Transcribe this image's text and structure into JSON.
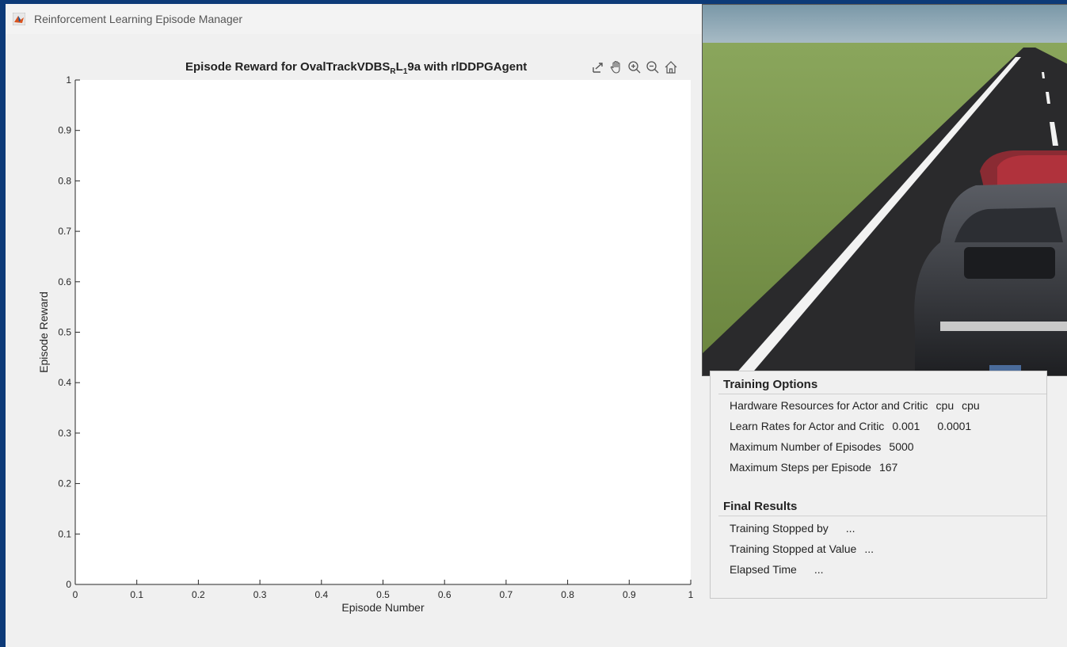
{
  "window": {
    "title": "Reinforcement Learning Episode Manager"
  },
  "plot": {
    "title_main": "Episode Reward for OvalTrackVDBS",
    "title_sub1": "R",
    "title_mid": "L",
    "title_sub2": "1",
    "title_end": "9a with rlDDPGAgent",
    "toolbar": [
      "export-icon",
      "pan-hand-icon",
      "zoom-in-icon",
      "zoom-out-icon",
      "home-icon"
    ]
  },
  "chart_data": {
    "type": "line",
    "title": "Episode Reward for OvalTrackVDBSRL19a with rlDDPGAgent",
    "xlabel": "Episode Number",
    "ylabel": "Episode Reward",
    "xlim": [
      0,
      1
    ],
    "ylim": [
      0,
      1
    ],
    "xticks": [
      "0",
      "0.1",
      "0.2",
      "0.3",
      "0.4",
      "0.5",
      "0.6",
      "0.7",
      "0.8",
      "0.9",
      "1"
    ],
    "yticks": [
      "0",
      "0.1",
      "0.2",
      "0.3",
      "0.4",
      "0.5",
      "0.6",
      "0.7",
      "0.8",
      "0.9",
      "1"
    ],
    "series": [],
    "grid": false
  },
  "training_options": {
    "heading": "Training Options",
    "hardware_label": "Hardware Resources for Actor and Critic",
    "hardware_actor": "cpu",
    "hardware_critic": "cpu",
    "learn_label": "Learn Rates for Actor and Critic",
    "learn_actor": "0.001",
    "learn_critic": "0.0001",
    "max_episodes_label": "Maximum Number of Episodes",
    "max_episodes": "5000",
    "max_steps_label": "Maximum Steps per Episode",
    "max_steps": "167"
  },
  "final_results": {
    "heading": "Final Results",
    "stopped_by_label": "Training Stopped by",
    "stopped_by": "...",
    "stopped_value_label": "Training Stopped at Value",
    "stopped_value": "...",
    "elapsed_label": "Elapsed Time",
    "elapsed": "..."
  },
  "colors": {
    "desktop": "#0d3a78",
    "window_bg": "#f0f0f0",
    "axes_bg": "#ffffff",
    "grass": "#7a9650",
    "road": "#2b2b2b"
  }
}
